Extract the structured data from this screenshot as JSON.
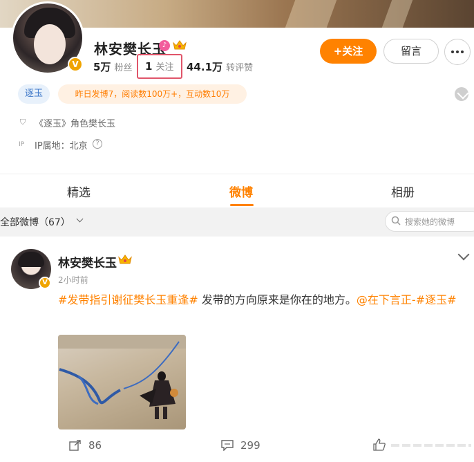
{
  "profile": {
    "name": "林安樊长玉",
    "fans_num": "5万",
    "fans_label": "粉丝",
    "follow_num": "1",
    "follow_label": "关注",
    "reposts_num": "44.1万",
    "reposts_label": "转评赞",
    "follow_button": "+关注",
    "message_button": "留言",
    "tag": "逐玉",
    "stats_tag": "昨日发博7，阅读数100万+，互动数10万",
    "role_info": "《逐玉》角色樊长玉",
    "ip_info": "IP属地：北京"
  },
  "tabs": [
    "精选",
    "微博",
    "相册"
  ],
  "active_tab": "微博",
  "filter": {
    "label": "全部微博（67）",
    "search_placeholder": "搜索她的微博"
  },
  "post": {
    "author": "林安樊长玉",
    "time": "2小时前",
    "hashtag1": "#发带指引谢征樊长玉重逢#",
    "text": " 发带的方向原来是你在的地方。",
    "mention": "@在下言正-",
    "hashtag2": "#逐玉#",
    "reposts": "86",
    "comments": "299"
  },
  "colors": {
    "accent": "#ff8200",
    "highlight_box": "#e0556a",
    "tag_blue": "#3e78c8"
  }
}
